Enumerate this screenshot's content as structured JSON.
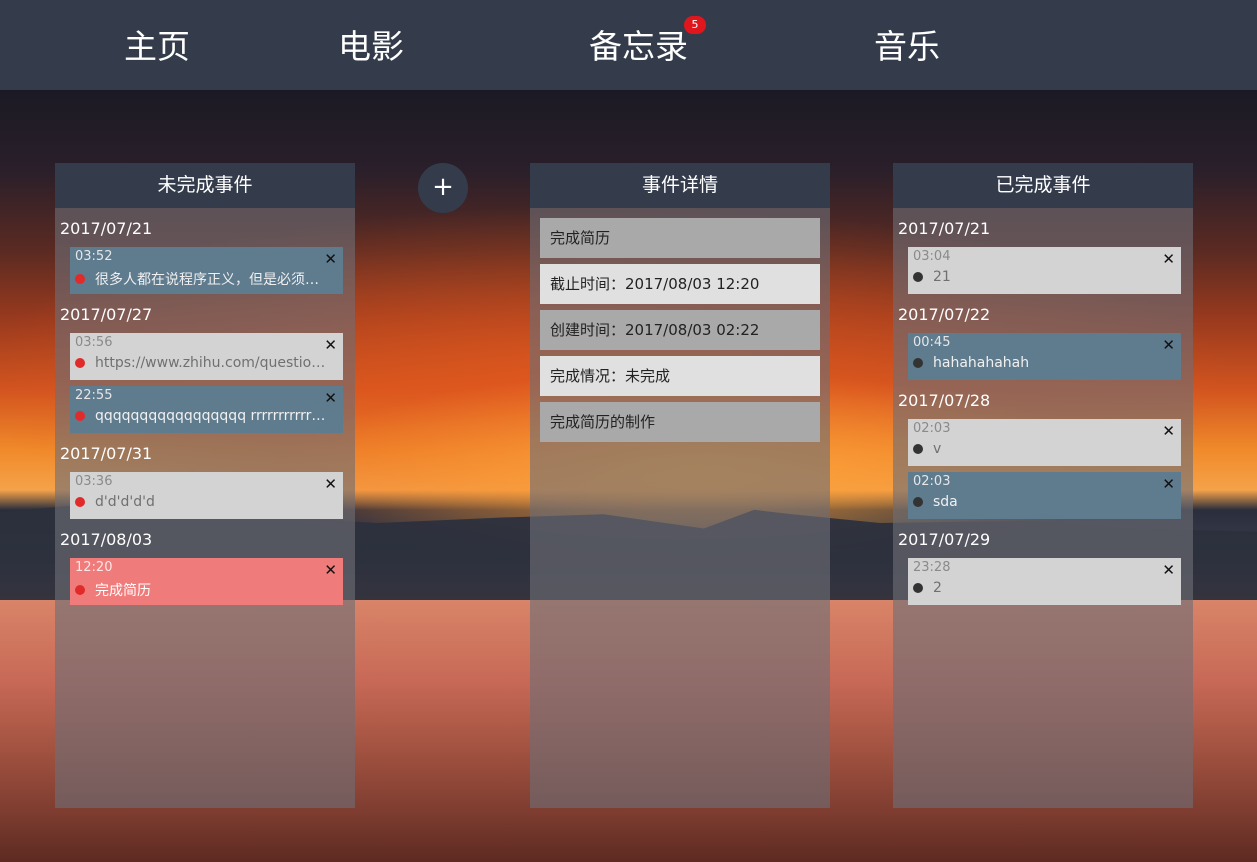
{
  "nav": {
    "items": [
      {
        "label": "主页"
      },
      {
        "label": "电影"
      },
      {
        "label": "备忘录",
        "badge": "5"
      },
      {
        "label": "音乐"
      }
    ]
  },
  "add_button": {
    "label": "+"
  },
  "pending": {
    "title": "未完成事件",
    "groups": [
      {
        "date": "2017/07/21",
        "events": [
          {
            "time": "03:52",
            "text": "很多人都在说程序正义，但是必须…",
            "color": "#5f7b8e"
          }
        ]
      },
      {
        "date": "2017/07/27",
        "events": [
          {
            "time": "03:56",
            "text": "https://www.zhihu.com/question…",
            "color": "#d3d3d3"
          },
          {
            "time": "22:55",
            "text": "qqqqqqqqqqqqqqqqq rrrrrrrrrrr…",
            "color": "#5f7b8e"
          }
        ]
      },
      {
        "date": "2017/07/31",
        "events": [
          {
            "time": "03:36",
            "text": "d'd'd'd'd",
            "color": "#d3d3d3"
          }
        ]
      },
      {
        "date": "2017/08/03",
        "events": [
          {
            "time": "12:20",
            "text": "完成简历",
            "color": "#f07b7b"
          }
        ]
      }
    ]
  },
  "details": {
    "title": "事件详情",
    "rows": [
      "完成简历",
      "截止时间：2017/08/03 12:20",
      "创建时间：2017/08/03 02:22",
      "完成情况：未完成",
      "完成简历的制作"
    ]
  },
  "done": {
    "title": "已完成事件",
    "groups": [
      {
        "date": "2017/07/21",
        "events": [
          {
            "time": "03:04",
            "text": "21",
            "color": "#d3d3d3"
          }
        ]
      },
      {
        "date": "2017/07/22",
        "events": [
          {
            "time": "00:45",
            "text": "hahahahahah",
            "color": "#5f7b8e"
          }
        ]
      },
      {
        "date": "2017/07/28",
        "events": [
          {
            "time": "02:03",
            "text": "v",
            "color": "#d3d3d3"
          },
          {
            "time": "02:03",
            "text": "sda",
            "color": "#5f7b8e"
          }
        ]
      },
      {
        "date": "2017/07/29",
        "events": [
          {
            "time": "23:28",
            "text": "2",
            "color": "#d3d3d3"
          }
        ]
      }
    ]
  },
  "close_glyph": "✕"
}
